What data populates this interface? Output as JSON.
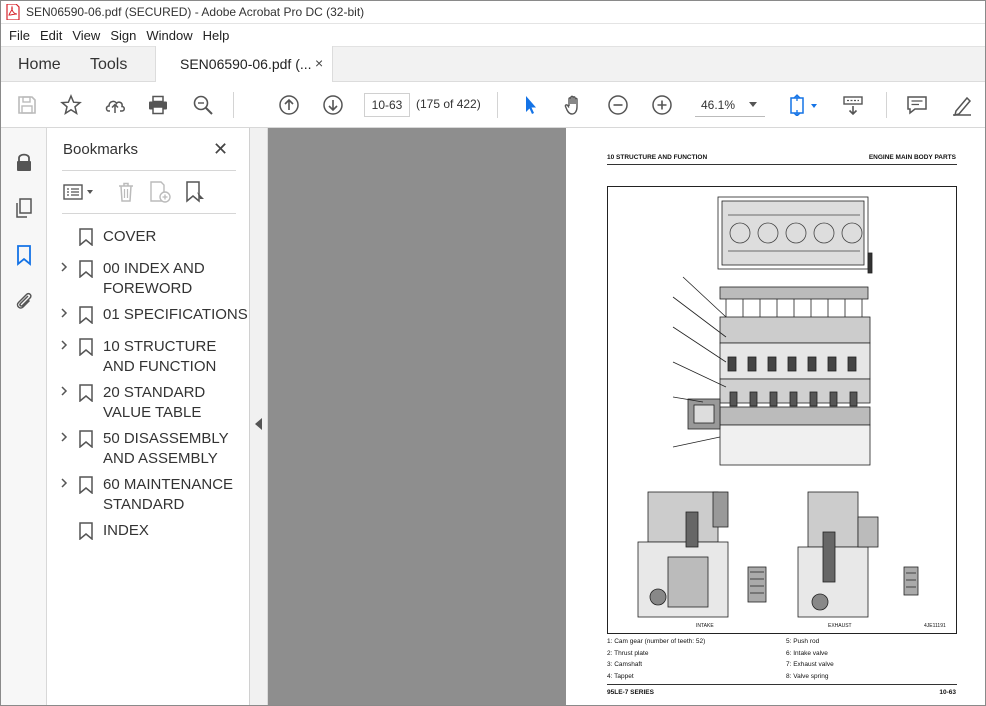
{
  "window": {
    "title": "SEN06590-06.pdf (SECURED) - Adobe Acrobat Pro DC (32-bit)"
  },
  "menu": [
    "File",
    "Edit",
    "View",
    "Sign",
    "Window",
    "Help"
  ],
  "tabs": {
    "home": "Home",
    "tools": "Tools",
    "document": "SEN06590-06.pdf (...",
    "close_glyph": "×"
  },
  "toolbar": {
    "page_input": "10-63",
    "page_count": "(175 of 422)",
    "zoom": "46.1%"
  },
  "bookmarks": {
    "title": "Bookmarks",
    "close_glyph": "✕",
    "items": [
      {
        "label": "COVER",
        "expandable": false
      },
      {
        "label": "00 INDEX AND FOREWORD",
        "expandable": true
      },
      {
        "label": "01 SPECIFICATIONS",
        "expandable": true
      },
      {
        "label": "10 STRUCTURE AND FUNCTION",
        "expandable": true
      },
      {
        "label": "20 STANDARD VALUE TABLE",
        "expandable": true
      },
      {
        "label": "50 DISASSEMBLY AND ASSEMBLY",
        "expandable": true
      },
      {
        "label": "60 MAINTENANCE STANDARD",
        "expandable": true
      },
      {
        "label": "INDEX",
        "expandable": false
      }
    ]
  },
  "pdf": {
    "header_left": "10 STRUCTURE AND FUNCTION",
    "header_right": "ENGINE MAIN BODY PARTS",
    "figure_label_intake": "INTAKE",
    "figure_label_exhaust": "EXHAUST",
    "figure_code": "4JE11191",
    "legend_left": [
      "1: Cam gear (number of teeth: 52)",
      "2: Thrust plate",
      "3: Camshaft",
      "4: Tappet"
    ],
    "legend_right": [
      "5: Push rod",
      "6: Intake valve",
      "7: Exhaust valve",
      "8: Valve spring"
    ],
    "footer_left": "95LE-7 SERIES",
    "footer_right": "10-63"
  },
  "colors": {
    "accent_blue": "#1473e6",
    "pdf_icon_red": "#d6232b",
    "doc_background": "#8e8e8e"
  }
}
